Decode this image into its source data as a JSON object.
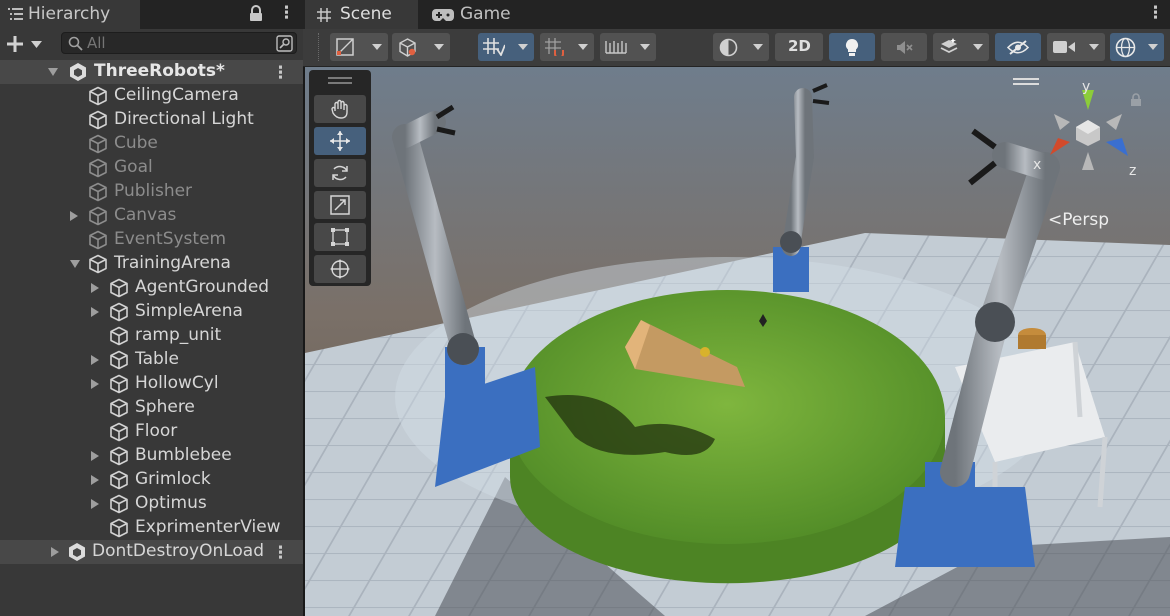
{
  "hierarchy": {
    "title": "Hierarchy",
    "search_placeholder": "All",
    "scene": "ThreeRobots*",
    "items": [
      {
        "label": "CeilingCamera"
      },
      {
        "label": "Directional Light"
      },
      {
        "label": "Cube"
      },
      {
        "label": "Goal"
      },
      {
        "label": "Publisher"
      },
      {
        "label": "Canvas"
      },
      {
        "label": "EventSystem"
      },
      {
        "label": "TrainingArena"
      },
      {
        "label": "AgentGrounded"
      },
      {
        "label": "SimpleArena"
      },
      {
        "label": "ramp_unit"
      },
      {
        "label": "Table"
      },
      {
        "label": "HollowCyl"
      },
      {
        "label": "Sphere"
      },
      {
        "label": "Floor"
      },
      {
        "label": "Bumblebee"
      },
      {
        "label": "Grimlock"
      },
      {
        "label": "Optimus"
      },
      {
        "label": "ExprimenterView"
      }
    ],
    "second_scene": "DontDestroyOnLoad"
  },
  "tabs": {
    "scene": "Scene",
    "game": "Game"
  },
  "toolbar": {
    "twod_label": "2D"
  },
  "gizmo": {
    "x": "x",
    "y": "y",
    "z": "z",
    "projection": "Persp"
  },
  "colors": {
    "accent": "#46607c",
    "panel": "#383838",
    "selected_row": "#484848"
  }
}
